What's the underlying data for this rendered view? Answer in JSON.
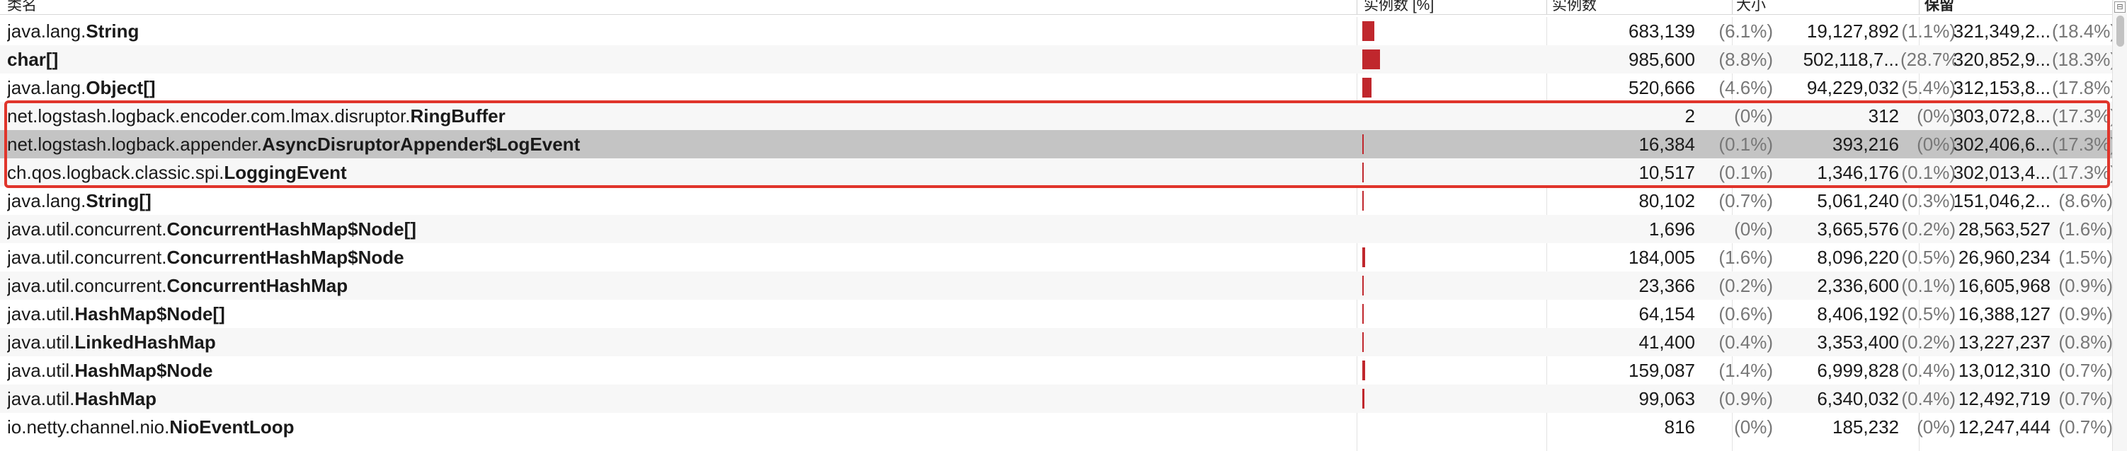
{
  "header": {
    "col_class": "类名",
    "col_bar": "实例数 [%]",
    "col_instances": "实例数",
    "col_size": "大小",
    "col_retained": "保留"
  },
  "scroll_icon": "table-settings-icon",
  "accent_color": "#c0272d",
  "highlight_color": "#e0352b",
  "rows": [
    {
      "pkg": "java.lang.",
      "cls": "String",
      "bar": 6.1,
      "inst": "683,139",
      "instp": "(6.1%)",
      "size": "19,127,892",
      "sizep": "(1.1%)",
      "ret": "321,349,2...",
      "retp": "(18.4%)"
    },
    {
      "pkg": "",
      "cls": "char[]",
      "bar": 8.8,
      "inst": "985,600",
      "instp": "(8.8%)",
      "size": "502,118,7...",
      "sizep": "(28.7%)",
      "ret": "320,852,9...",
      "retp": "(18.3%)"
    },
    {
      "pkg": "java.lang.",
      "cls": "Object[]",
      "bar": 4.6,
      "inst": "520,666",
      "instp": "(4.6%)",
      "size": "94,229,032",
      "sizep": "(5.4%)",
      "ret": "312,153,8...",
      "retp": "(17.8%)"
    },
    {
      "pkg": "net.logstash.logback.encoder.com.lmax.disruptor.",
      "cls": "RingBuffer",
      "bar": 0,
      "inst": "2",
      "instp": "(0%)",
      "size": "312",
      "sizep": "(0%)",
      "ret": "303,072,8...",
      "retp": "(17.3%)"
    },
    {
      "pkg": "net.logstash.logback.appender.",
      "cls": "AsyncDisruptorAppender$LogEvent",
      "bar": 0.1,
      "inst": "16,384",
      "instp": "(0.1%)",
      "size": "393,216",
      "sizep": "(0%)",
      "ret": "302,406,6...",
      "retp": "(17.3%)"
    },
    {
      "pkg": "ch.qos.logback.classic.spi.",
      "cls": "LoggingEvent",
      "bar": 0.1,
      "inst": "10,517",
      "instp": "(0.1%)",
      "size": "1,346,176",
      "sizep": "(0.1%)",
      "ret": "302,013,4...",
      "retp": "(17.3%)"
    },
    {
      "pkg": "java.lang.",
      "cls": "String[]",
      "bar": 0.7,
      "inst": "80,102",
      "instp": "(0.7%)",
      "size": "5,061,240",
      "sizep": "(0.3%)",
      "ret": "151,046,2...",
      "retp": "(8.6%)"
    },
    {
      "pkg": "java.util.concurrent.",
      "cls": "ConcurrentHashMap$Node[]",
      "bar": 0,
      "inst": "1,696",
      "instp": "(0%)",
      "size": "3,665,576",
      "sizep": "(0.2%)",
      "ret": "28,563,527",
      "retp": "(1.6%)"
    },
    {
      "pkg": "java.util.concurrent.",
      "cls": "ConcurrentHashMap$Node",
      "bar": 1.6,
      "inst": "184,005",
      "instp": "(1.6%)",
      "size": "8,096,220",
      "sizep": "(0.5%)",
      "ret": "26,960,234",
      "retp": "(1.5%)"
    },
    {
      "pkg": "java.util.concurrent.",
      "cls": "ConcurrentHashMap",
      "bar": 0.2,
      "inst": "23,366",
      "instp": "(0.2%)",
      "size": "2,336,600",
      "sizep": "(0.1%)",
      "ret": "16,605,968",
      "retp": "(0.9%)"
    },
    {
      "pkg": "java.util.",
      "cls": "HashMap$Node[]",
      "bar": 0.6,
      "inst": "64,154",
      "instp": "(0.6%)",
      "size": "8,406,192",
      "sizep": "(0.5%)",
      "ret": "16,388,127",
      "retp": "(0.9%)"
    },
    {
      "pkg": "java.util.",
      "cls": "LinkedHashMap",
      "bar": 0.4,
      "inst": "41,400",
      "instp": "(0.4%)",
      "size": "3,353,400",
      "sizep": "(0.2%)",
      "ret": "13,227,237",
      "retp": "(0.8%)"
    },
    {
      "pkg": "java.util.",
      "cls": "HashMap$Node",
      "bar": 1.4,
      "inst": "159,087",
      "instp": "(1.4%)",
      "size": "6,999,828",
      "sizep": "(0.4%)",
      "ret": "13,012,310",
      "retp": "(0.7%)"
    },
    {
      "pkg": "java.util.",
      "cls": "HashMap",
      "bar": 0.9,
      "inst": "99,063",
      "instp": "(0.9%)",
      "size": "6,340,032",
      "sizep": "(0.4%)",
      "ret": "12,492,719",
      "retp": "(0.7%)"
    },
    {
      "pkg": "io.netty.channel.nio.",
      "cls": "NioEventLoop",
      "bar": 0,
      "inst": "816",
      "instp": "(0%)",
      "size": "185,232",
      "sizep": "(0%)",
      "ret": "12,247,444",
      "retp": "(0.7%)"
    }
  ],
  "selected_row": 4
}
